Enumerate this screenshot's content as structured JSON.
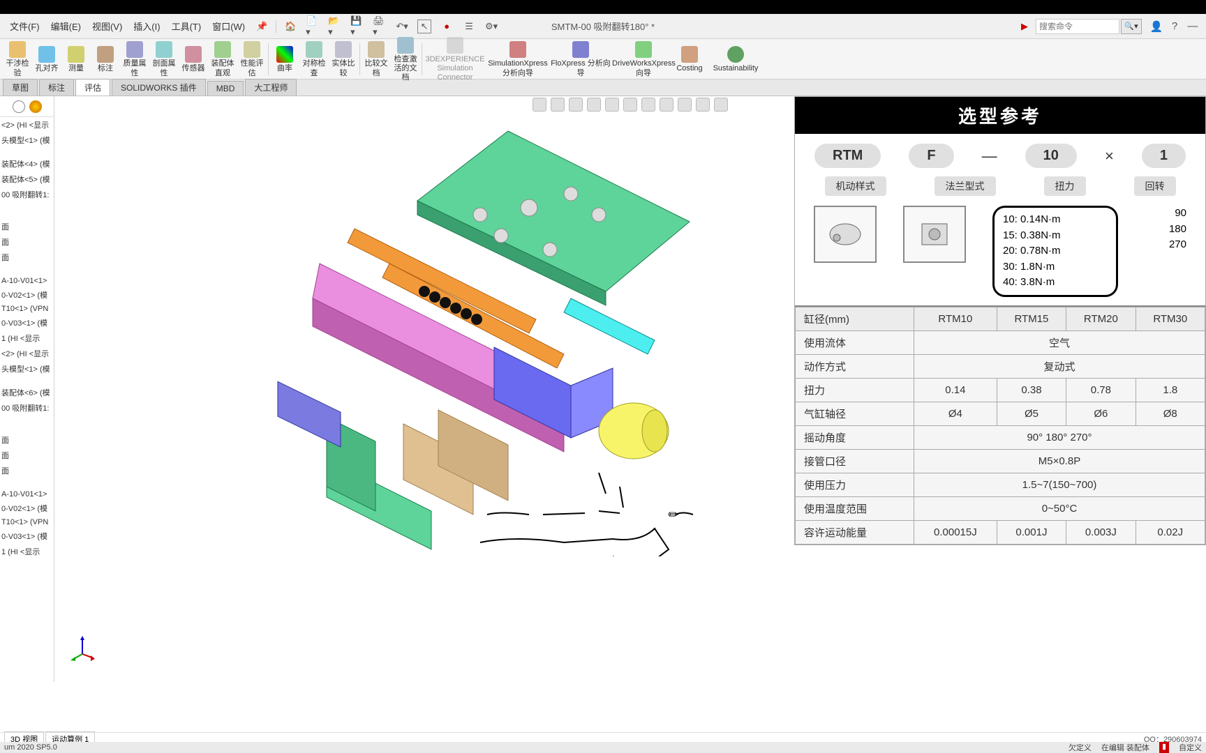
{
  "menu": {
    "file": "文件(F)",
    "edit": "编辑(E)",
    "view": "视图(V)",
    "insert": "插入(I)",
    "tool": "工具(T)",
    "window": "窗口(W)",
    "search_ph": "搜索命令"
  },
  "title": "SMTM-00 吸附翻转180° *",
  "ribbon": {
    "b1": "干涉检验",
    "b2": "孔对齐",
    "b3": "测量",
    "b4": "标注",
    "b5": "质量属性",
    "b6": "剖面属性",
    "b7": "传感器",
    "b8": "装配体直观",
    "b9": "性能评估",
    "b10": "曲率",
    "b11": "对称检查",
    "b12": "实体比较",
    "b13": "比较文档",
    "b14": "检查激活的文档",
    "c1": "3DEXPERIENCE Simulation Connector",
    "c2": "SimulationXpress 分析向导",
    "c3": "FloXpress 分析向导",
    "c4": "DriveWorksXpress 向导",
    "c5": "Costing",
    "c6": "Sustainability"
  },
  "tabs": {
    "t1": "草图",
    "t2": "标注",
    "t3": "评估",
    "t4": "SOLIDWORKS 插件",
    "t5": "MBD",
    "t6": "大工程师"
  },
  "tree": {
    "i1": "<2> (HI <显示",
    "i2": "头模型<1> (模",
    "i3": "装配体<4> (模",
    "i4": "装配体<5> (模",
    "i5": "00 吸附翻转1:",
    "i6": "面",
    "i7": "面",
    "i8": "面",
    "i9": "A-10-V01<1>",
    "i10": "0-V02<1> (模",
    "i11": "T10<1> (VPN",
    "i12": "0-V03<1> (模",
    "i13": "1 (HI <显示",
    "i14": "<2> (HI <显示",
    "i15": "头模型<1> (模",
    "i16": "装配体<6> (模",
    "i17": "00 吸附翻转1:",
    "i18": "面",
    "i19": "面",
    "i20": "面",
    "i21": "A-10-V01<1>",
    "i22": "0-V02<1> (模",
    "i23": "T10<1> (VPN",
    "i24": "0-V03<1> (模",
    "i25": "1 (HI <显示"
  },
  "ref": {
    "title": "选型参考",
    "p1": "RTM",
    "p2": "F",
    "p3": "10",
    "p4": "1",
    "l1": "机动样式",
    "l2": "法兰型式",
    "l3": "扭力",
    "l4": "回转",
    "torque": [
      "10:  0.14N·m",
      "15:  0.38N·m",
      "20:  0.78N·m",
      "30:   1.8N·m",
      "40:   3.8N·m"
    ],
    "angle": [
      "90",
      "180",
      "270"
    ]
  },
  "spec": {
    "h0": "缸径(mm)",
    "h1": "RTM10",
    "h2": "RTM15",
    "h3": "RTM20",
    "h4": "RTM30",
    "r1": "使用流体",
    "v1": "空气",
    "r2": "动作方式",
    "v2": "复动式",
    "r3": "扭力",
    "v3a": "0.14",
    "v3b": "0.38",
    "v3c": "0.78",
    "v3d": "1.8",
    "r4": "气缸轴径",
    "v4a": "Ø4",
    "v4b": "Ø5",
    "v4c": "Ø6",
    "v4d": "Ø8",
    "r5": "摇动角度",
    "v5": "90° 180° 270°",
    "r6": "接管口径",
    "v6": "M5×0.8P",
    "r7": "使用压力",
    "v7": "1.5~7(150~700)",
    "r8": "使用温度范围",
    "v8": "0~50°C",
    "r9": "容许运动能量",
    "v9a": "0.00015J",
    "v9b": "0.001J",
    "v9c": "0.003J",
    "v9d": "0.02J"
  },
  "bottom": {
    "t1": "3D 视图",
    "t2": "运动算例 1",
    "qq": "QQ：290603974"
  },
  "status": {
    "ver": "um 2020 SP5.0",
    "s1": "欠定义",
    "s2": "在编辑 装配体",
    "s3": "自定义"
  }
}
